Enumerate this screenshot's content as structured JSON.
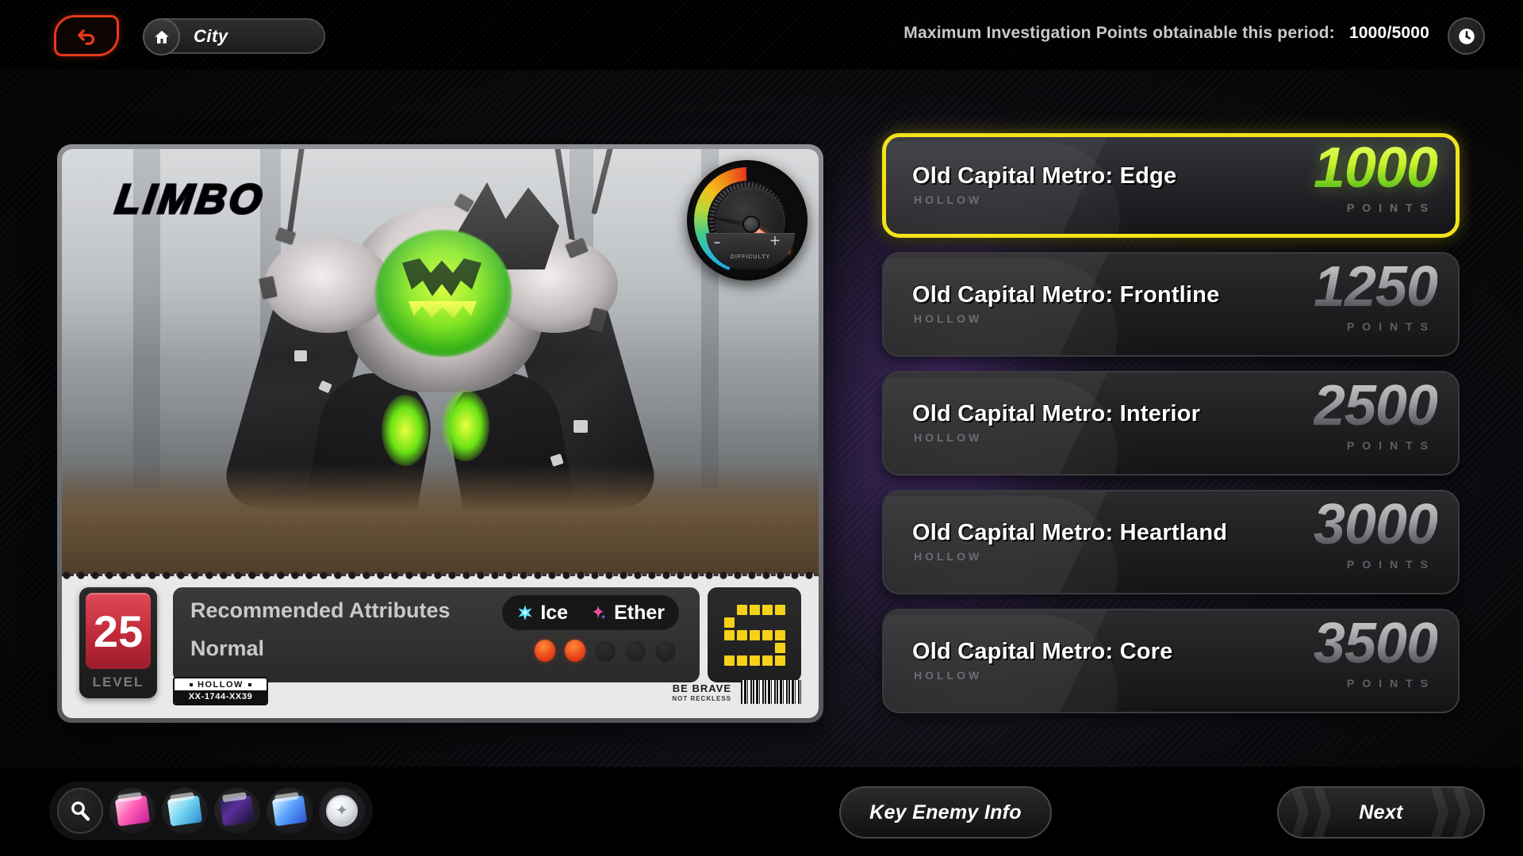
{
  "header": {
    "back_icon": "back-arrow-icon",
    "home_icon": "home-icon",
    "breadcrumb": "City",
    "points_label": "Maximum Investigation Points obtainable this period:",
    "points_value": "1000/5000",
    "help_icon": "help-clock-icon"
  },
  "card": {
    "logo": "LIMBO",
    "gauge": {
      "label": "DIFFICULTY",
      "minus": "−",
      "plus": "＋",
      "up_icon": "triangle-up-icon"
    },
    "level": {
      "value": "25",
      "label": "LEVEL"
    },
    "attributes": {
      "title": "Recommended Attributes",
      "difficulty_label": "Normal",
      "elements": [
        {
          "name": "Ice",
          "icon": "ice-star-icon",
          "color": "#5fe8ff"
        },
        {
          "name": "Ether",
          "icon": "ether-star-icon",
          "color": "#f055d8"
        }
      ],
      "dots_total": 5,
      "dots_filled": 2,
      "rank": "S"
    },
    "tag": {
      "name": "HOLLOW",
      "code": "XX-1744-XX39"
    },
    "motto_line1": "BE BRAVE",
    "motto_line2": "NOT RECKLESS",
    "barcode": "barcode-icon"
  },
  "missions": {
    "points_unit": "POINTS",
    "items": [
      {
        "title": "Old Capital Metro: Edge",
        "sub": "HOLLOW",
        "points": "1000",
        "selected": true
      },
      {
        "title": "Old Capital Metro: Frontline",
        "sub": "HOLLOW",
        "points": "1250",
        "selected": false
      },
      {
        "title": "Old Capital Metro: Interior",
        "sub": "HOLLOW",
        "points": "2500",
        "selected": false
      },
      {
        "title": "Old Capital Metro: Heartland",
        "sub": "HOLLOW",
        "points": "3000",
        "selected": false
      },
      {
        "title": "Old Capital Metro: Core",
        "sub": "HOLLOW",
        "points": "3500",
        "selected": false
      }
    ]
  },
  "footer": {
    "tools": [
      {
        "icon": "search-icon"
      },
      {
        "icon": "pink-card-pack-icon"
      },
      {
        "icon": "blue-ticket-icon"
      },
      {
        "icon": "dark-star-pack-icon"
      },
      {
        "icon": "blue-card-pack-icon"
      },
      {
        "icon": "white-medal-icon"
      }
    ],
    "key_enemy_info": "Key Enemy Info",
    "next": "Next"
  },
  "colors": {
    "accent_yellow": "#f2e31b",
    "accent_green": "#c8f22a",
    "accent_red": "#e8381a",
    "level_red": "#c12a3a"
  }
}
